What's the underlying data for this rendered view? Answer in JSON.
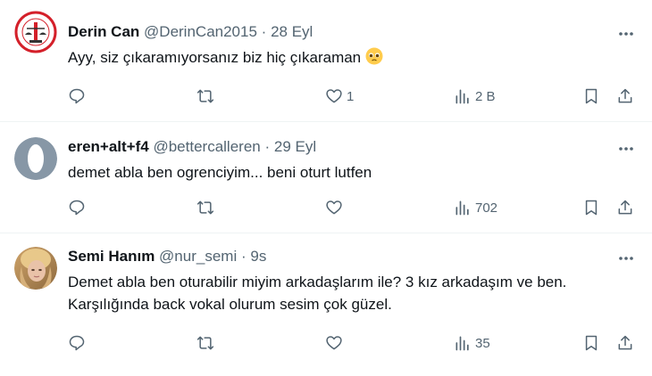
{
  "tweets": [
    {
      "name": "Derin Can",
      "handle": "@DerinCan2015",
      "sep": "·",
      "time": "28 Eyl",
      "text": "Ayy, siz çıkaramıyorsanız biz hiç çıkaraman",
      "emoji": "pleading-face-emoji",
      "likes": "1",
      "views": "2 B",
      "avatar_icon": "justice-party-seal-icon"
    },
    {
      "name": "eren+alt+f4",
      "handle": "@bettercalleren",
      "sep": "·",
      "time": "29 Eyl",
      "text": "demet abla ben ogrenciyim... beni oturt lutfen",
      "likes": "",
      "views": "702",
      "avatar_icon": "default-oval-avatar-icon"
    },
    {
      "name": "Semi Hanım",
      "handle": "@nur_semi",
      "sep": "·",
      "time": "9s",
      "text_line1": "Demet abla ben oturabilir miyim arkadaşlarım ile? 3 kız arkadaşım ve ben.",
      "text_line2": "Karşılığında back vokal olurum sesim çok güzel.",
      "likes": "",
      "views": "35",
      "avatar_icon": "profile-photo-avatar"
    }
  ],
  "colors": {
    "text": "#0f1419",
    "muted": "#536471",
    "divider": "#eff3f4",
    "accent_red": "#d4202a"
  }
}
